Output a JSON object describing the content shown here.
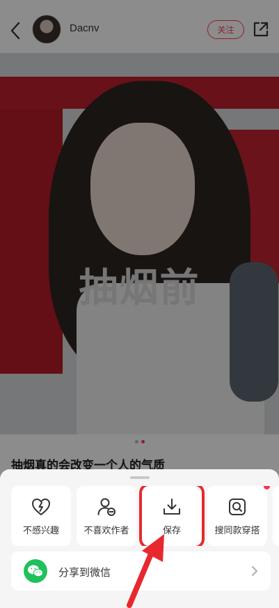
{
  "header": {
    "author_name": "Dacnv",
    "follow_label": "关注",
    "back_icon": "chevron-left-icon",
    "share_icon": "share-external-icon"
  },
  "photo": {
    "overlay_text": "抽烟前",
    "carousel": {
      "total": 2,
      "active": 2
    }
  },
  "post": {
    "title": "抽烟真的会改变一个人的气质"
  },
  "sheet": {
    "actions": [
      {
        "label": "不感兴趣",
        "icon": "broken-heart-icon"
      },
      {
        "label": "不喜欢作者",
        "icon": "user-minus-icon"
      },
      {
        "label": "保存",
        "icon": "download-icon"
      },
      {
        "label": "搜同款穿搭",
        "icon": "image-search-icon"
      }
    ],
    "share_wechat_label": "分享到微信",
    "share_wechat_icon": "wechat-icon"
  },
  "colors": {
    "accent": "#ff3b4d",
    "wechat": "#20c05c",
    "annotation": "#e8282f"
  }
}
